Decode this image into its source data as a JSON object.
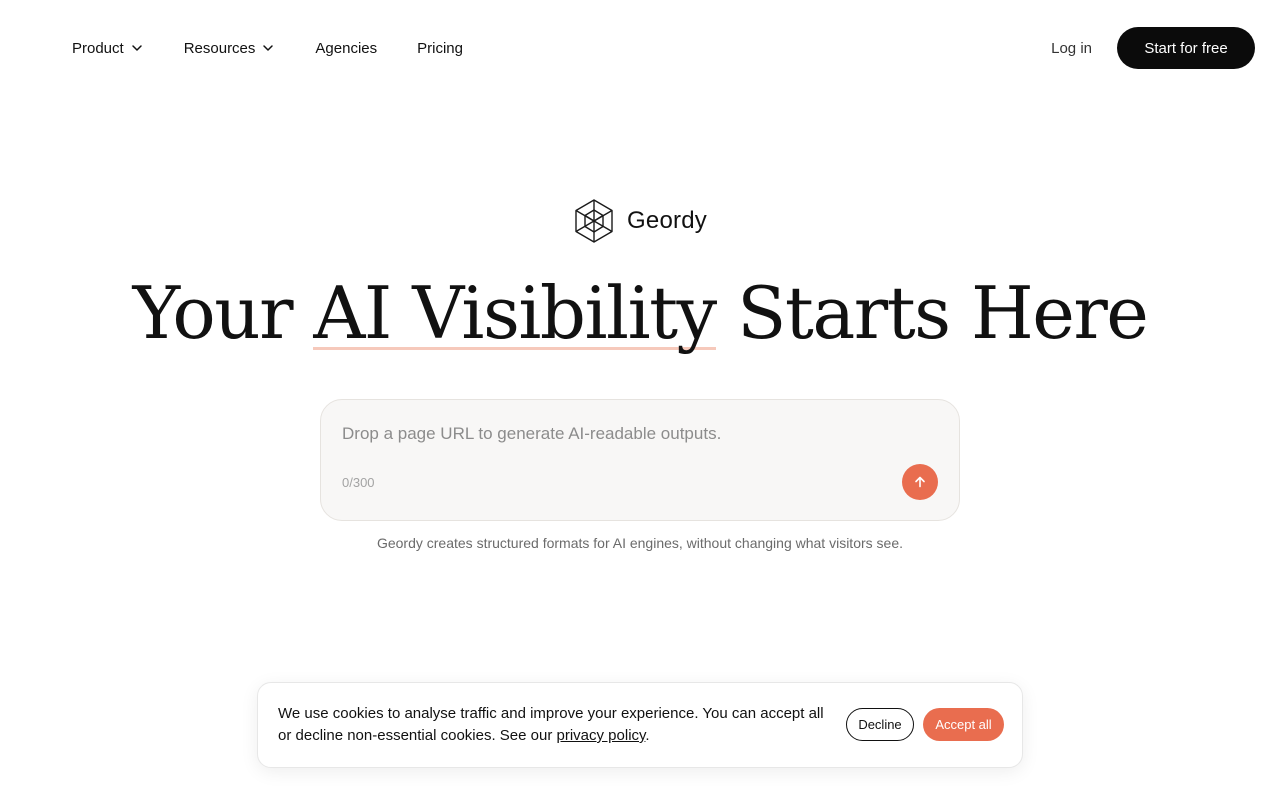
{
  "nav": {
    "items": [
      {
        "label": "Product",
        "icon": "chevron-down-icon"
      },
      {
        "label": "Resources",
        "icon": "chevron-down-icon"
      },
      {
        "label": "Agencies"
      },
      {
        "label": "Pricing"
      }
    ],
    "login_label": "Log in",
    "cta_label": "Start for free"
  },
  "brand": {
    "name": "Geordy",
    "logo_icon": "geordy-cube-logo-icon"
  },
  "hero": {
    "title_before": "Your ",
    "title_highlight": "AI Visibility",
    "title_after": " Starts Here"
  },
  "url_input": {
    "placeholder": "Drop a page URL to generate AI-readable outputs.",
    "value": "",
    "counter": "0/300",
    "submit_icon": "arrow-up-icon"
  },
  "caption": "Geordy creates structured formats for AI engines, without changing what visitors see.",
  "cookie_banner": {
    "text": "We use cookies to analyse traffic and improve your experience. You can accept all or decline non-essential cookies. See our ",
    "link_label": "privacy policy",
    "text_end": ".",
    "decline_label": "Decline",
    "accept_label": "Accept all"
  },
  "colors": {
    "accent": "#e96d4f",
    "highlight_underline": "#f6c9bb",
    "cta_background": "#0b0b0b",
    "card_background": "#f8f7f6"
  }
}
